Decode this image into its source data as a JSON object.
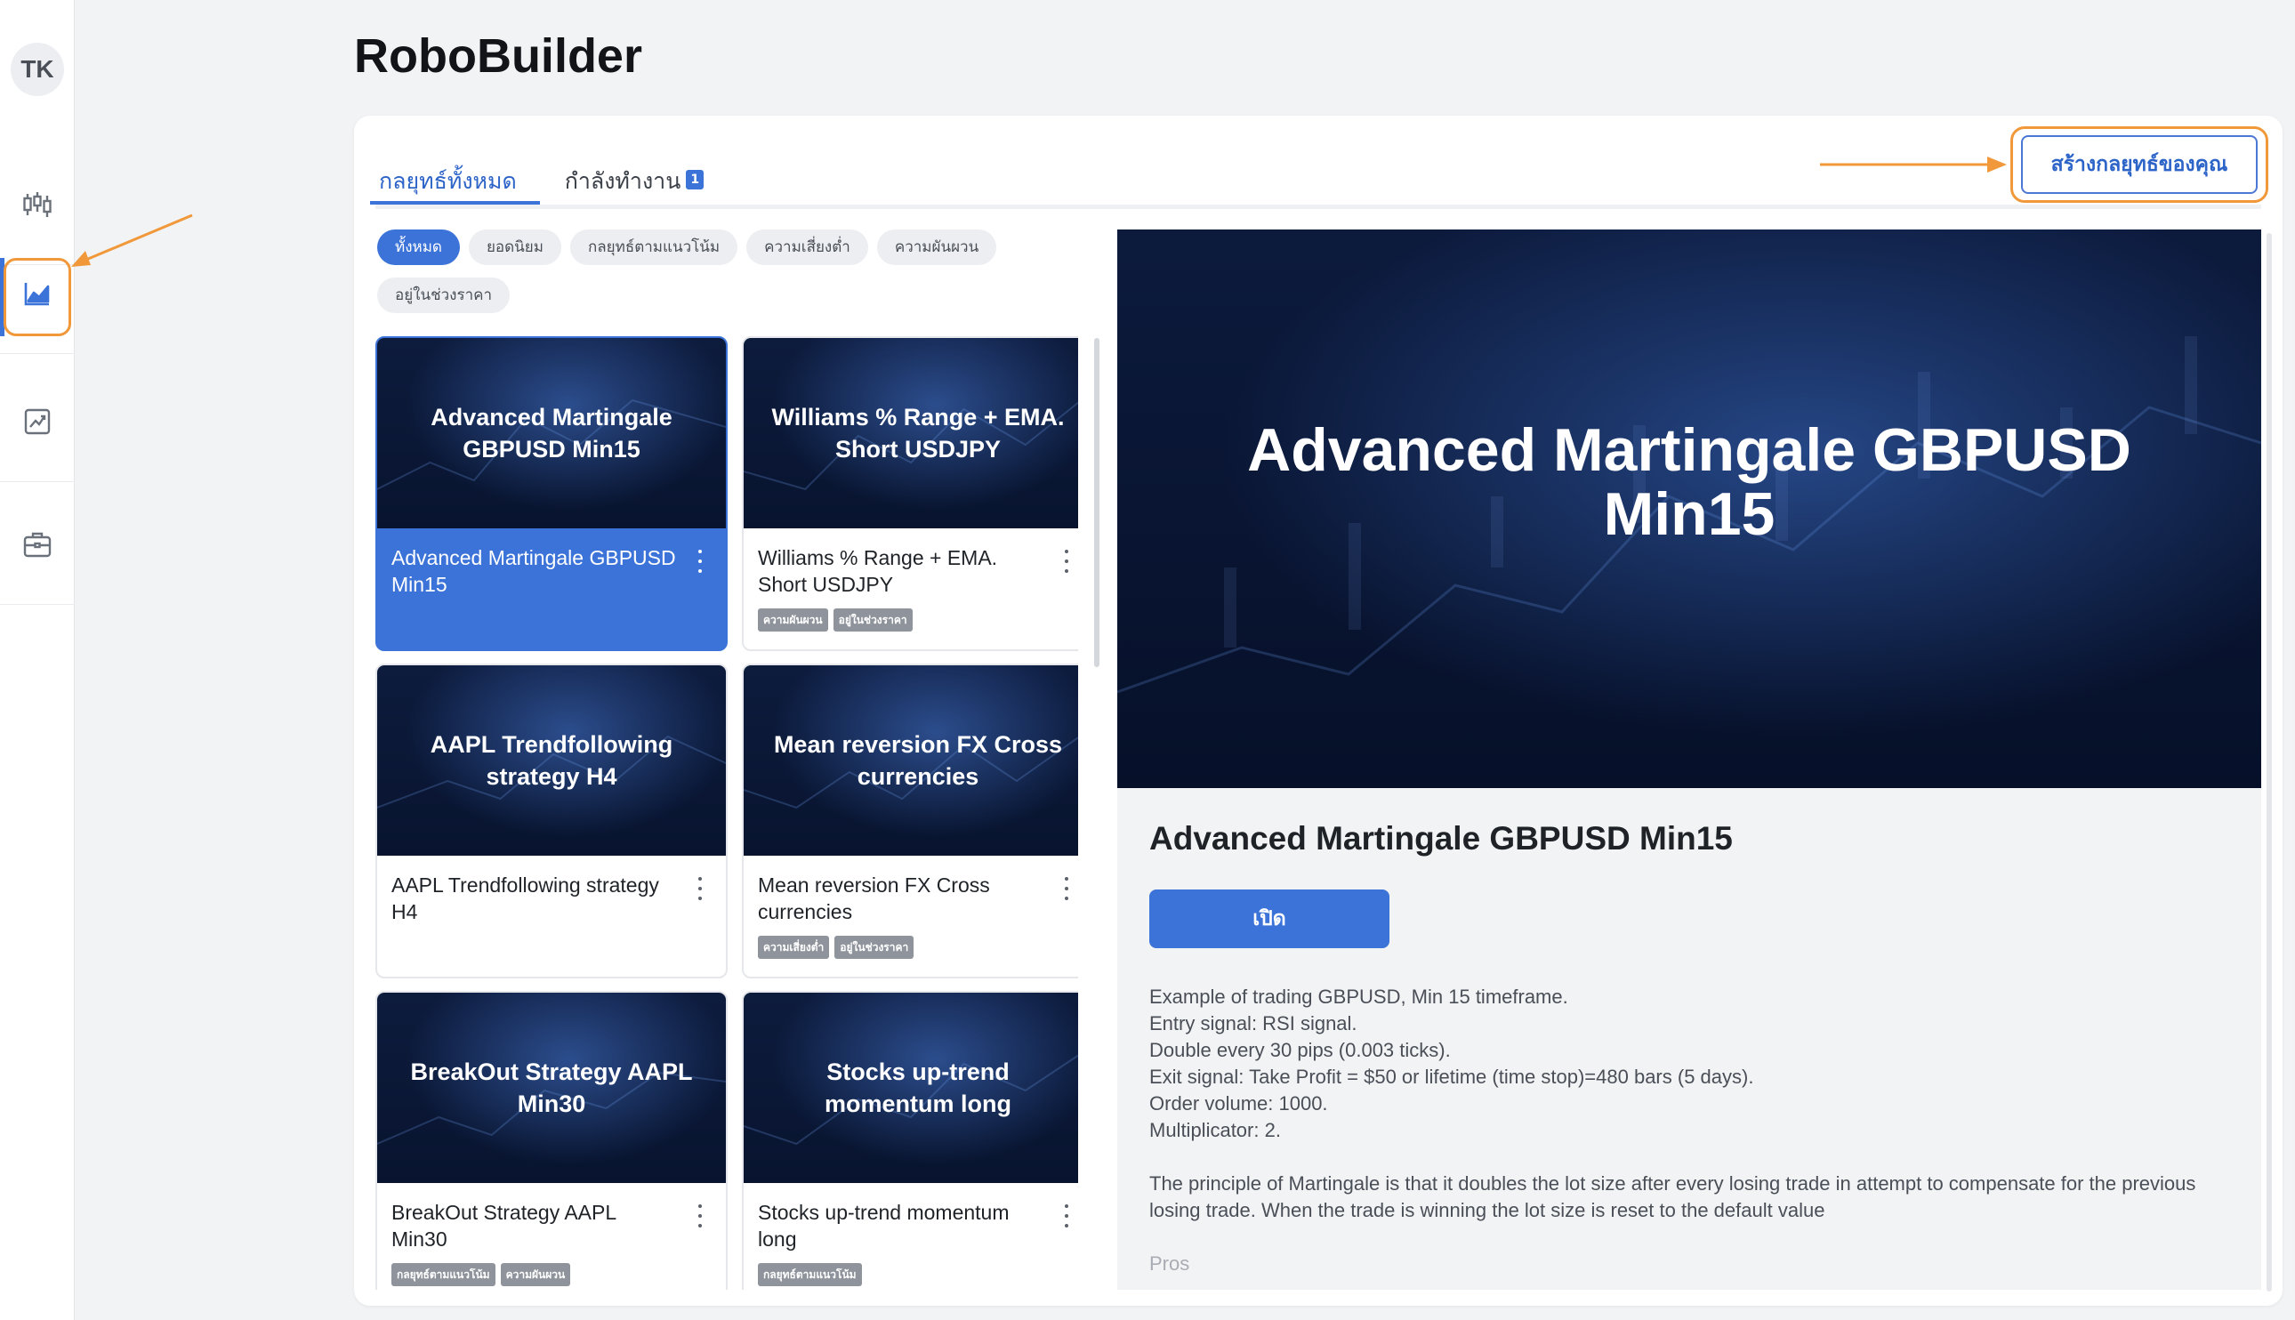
{
  "sidebar": {
    "avatar_initials": "TK",
    "items": [
      {
        "name": "sidebar-item-charts",
        "icon": "candlestick-icon"
      },
      {
        "name": "sidebar-item-robobuilder",
        "icon": "area-chart-icon",
        "active": true
      },
      {
        "name": "sidebar-item-analytics",
        "icon": "trend-chart-icon"
      },
      {
        "name": "sidebar-item-portfolio",
        "icon": "briefcase-icon"
      }
    ]
  },
  "page": {
    "title": "RoboBuilder"
  },
  "tabs": {
    "all_label": "กลยุทธ์ทั้งหมด",
    "running_label": "กำลังทำงาน",
    "running_count": "1"
  },
  "create_button": {
    "label": "สร้างกลยุทธ์ของคุณ"
  },
  "filters": [
    {
      "label": "ทั้งหมด",
      "active": true
    },
    {
      "label": "ยอดนิยม"
    },
    {
      "label": "กลยุทธ์ตามแนวโน้ม"
    },
    {
      "label": "ความเสี่ยงต่ำ"
    },
    {
      "label": "ความผันผวน"
    },
    {
      "label": "อยู่ในช่วงราคา"
    }
  ],
  "strategies": [
    {
      "thumb": "Advanced Martingale GBPUSD Min15",
      "name": "Advanced Martingale GBPUSD Min15",
      "selected": true,
      "tags": []
    },
    {
      "thumb": "Williams % Range + EMA. Short USDJPY",
      "name": "Williams % Range + EMA. Short USDJPY",
      "tags": [
        "ความผันผวน",
        "อยู่ในช่วงราคา"
      ]
    },
    {
      "thumb": "AAPL Trendfollowing strategy H4",
      "name": "AAPL Trendfollowing strategy H4",
      "tags": []
    },
    {
      "thumb": "Mean reversion FX Cross currencies",
      "name": "Mean reversion FX Cross currencies",
      "tags": [
        "ความเสี่ยงต่ำ",
        "อยู่ในช่วงราคา"
      ]
    },
    {
      "thumb": "BreakOut Strategy AAPL Min30",
      "name": "BreakOut Strategy AAPL Min30",
      "tags": [
        "กลยุทธ์ตามแนวโน้ม",
        "ความผันผวน"
      ]
    },
    {
      "thumb": "Stocks up-trend momentum long",
      "name": "Stocks up-trend momentum long",
      "tags": [
        "กลยุทธ์ตามแนวโน้ม"
      ]
    }
  ],
  "detail": {
    "hero_title": "Advanced Martingale GBPUSD Min15",
    "title": "Advanced Martingale GBPUSD Min15",
    "open_label": "เปิด",
    "description_lines": [
      "Example of trading GBPUSD, Min 15 timeframe.",
      "Entry signal: RSI signal.",
      "Double every 30 pips (0.003 ticks).",
      "Exit signal: Take Profit = $50 or lifetime (time stop)=480 bars (5 days).",
      "Order volume: 1000.",
      "Multiplicator: 2."
    ],
    "principle": "The principle of Martingale is that it doubles the lot size after every losing trade in attempt to compensate for the previous losing trade. When the trade is winning the lot size is reset to the default value",
    "pros_label": "Pros"
  },
  "colors": {
    "accent": "#3b73d8",
    "highlight": "#f0983a",
    "thumb_bg": "#0d1b3d"
  }
}
